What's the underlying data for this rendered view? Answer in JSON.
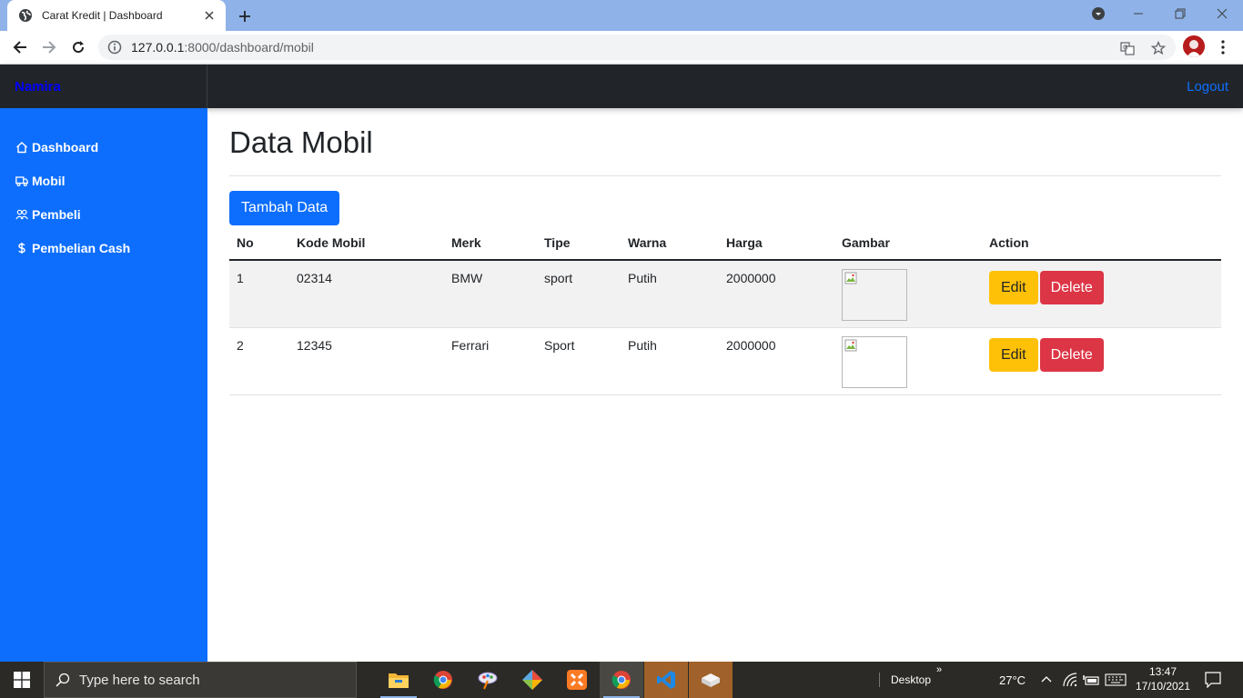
{
  "browser": {
    "tab_title": "Carat Kredit | Dashboard",
    "url_host": "127.0.0.1",
    "url_rest": ":8000/dashboard/mobil"
  },
  "navbar": {
    "brand": "Namira",
    "logout": "Logout"
  },
  "sidebar": {
    "items": [
      {
        "label": "Dashboard",
        "icon": "home-icon"
      },
      {
        "label": "Mobil",
        "icon": "truck-icon"
      },
      {
        "label": "Pembeli",
        "icon": "people-icon"
      },
      {
        "label": "Pembelian Cash",
        "icon": "dollar-icon"
      }
    ]
  },
  "main": {
    "title": "Data Mobil",
    "add_button": "Tambah Data",
    "table": {
      "headers": [
        "No",
        "Kode Mobil",
        "Merk",
        "Tipe",
        "Warna",
        "Harga",
        "Gambar",
        "Action"
      ],
      "rows": [
        {
          "no": "1",
          "kode": "02314",
          "merk": "BMW",
          "tipe": "sport",
          "warna": "Putih",
          "harga": "2000000"
        },
        {
          "no": "2",
          "kode": "12345",
          "merk": "Ferrari",
          "tipe": "Sport",
          "warna": "Putih",
          "harga": "2000000"
        }
      ],
      "edit_label": "Edit",
      "delete_label": "Delete"
    }
  },
  "taskbar": {
    "search_placeholder": "Type here to search",
    "desktop_label": "Desktop",
    "chevron": "»",
    "temperature": "27°C",
    "time": "13:47",
    "date": "17/10/2021"
  },
  "colors": {
    "sidebar": "#0d6efd",
    "navbar": "#212529",
    "edit": "#ffc107",
    "delete": "#dc3545",
    "primary": "#0d6efd"
  }
}
